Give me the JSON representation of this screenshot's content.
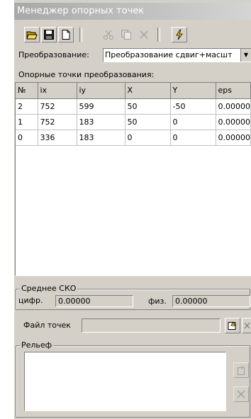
{
  "window": {
    "title": "Менеджер опорных точек"
  },
  "toolbar": {
    "open_icon": "open-folder-icon",
    "save_icon": "save-disk-icon",
    "new_icon": "new-document-icon",
    "cut_icon": "cut-icon",
    "copy_icon": "copy-icon",
    "delete_icon": "delete-x-icon",
    "lightning_icon": "lightning-icon"
  },
  "transform": {
    "label": "Преобразование:",
    "value": "Преобразование сдвиг+масшт"
  },
  "points": {
    "caption": "Опорные точки преобразования:",
    "columns": [
      "№",
      "ix",
      "iy",
      "X",
      "Y",
      "eps"
    ],
    "rows": [
      [
        "2",
        "752",
        "599",
        "50",
        "-50",
        "0.00000"
      ],
      [
        "1",
        "752",
        "183",
        "50",
        "0",
        "0.00000"
      ],
      [
        "0",
        "336",
        "183",
        "0",
        "0",
        "0.00000"
      ]
    ]
  },
  "sko": {
    "title": "Среднее СКО",
    "digital_label": "цифр.",
    "digital_value": "0.00000",
    "physical_label": "физ.",
    "physical_value": "0.00000"
  },
  "file": {
    "label": "Файл точек",
    "value": ""
  },
  "relief": {
    "title": "Рельеф"
  }
}
